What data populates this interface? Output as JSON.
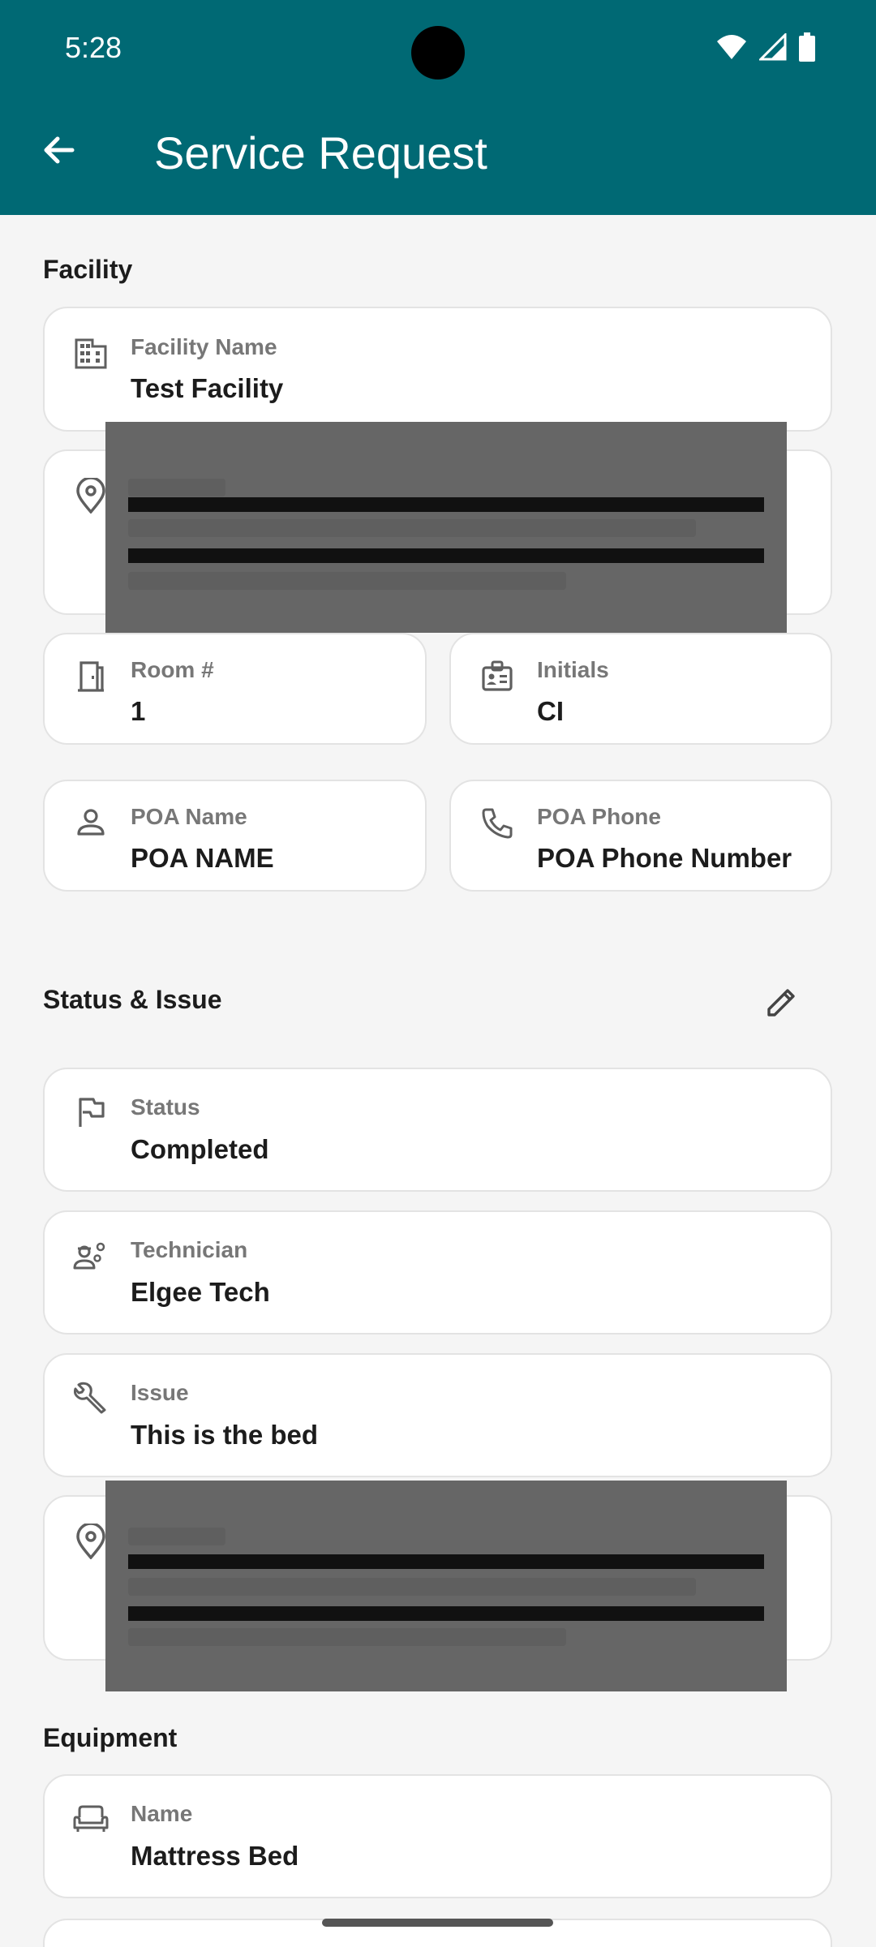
{
  "status_bar": {
    "time": "5:28"
  },
  "header": {
    "title": "Service Request"
  },
  "facility": {
    "section_title": "Facility",
    "facility_name_label": "Facility Name",
    "facility_name_value": "Test Facility",
    "room_label": "Room #",
    "room_value": "1",
    "initials_label": "Initials",
    "initials_value": "CI",
    "poa_name_label": "POA Name",
    "poa_name_value": "POA NAME",
    "poa_phone_label": "POA Phone",
    "poa_phone_value": "POA Phone Number"
  },
  "status_issue": {
    "section_title": "Status & Issue",
    "status_label": "Status",
    "status_value": "Completed",
    "technician_label": "Technician",
    "technician_value": "Elgee Tech",
    "issue_label": "Issue",
    "issue_value": "This is the bed"
  },
  "equipment": {
    "section_title": "Equipment",
    "name_label": "Name",
    "name_value": "Mattress Bed"
  },
  "icons": {
    "back": "arrow-back-icon",
    "edit": "pencil-icon",
    "facility": "building-icon",
    "address": "location-pin-icon",
    "room": "door-icon",
    "initials": "badge-icon",
    "poa_name": "person-icon",
    "poa_phone": "phone-icon",
    "status": "flag-icon",
    "technician": "engineer-icon",
    "issue": "wrench-icon",
    "equipment_name": "sofa-icon"
  },
  "colors": {
    "app_bar": "#006974",
    "background": "#f5f5f5",
    "card": "#ffffff",
    "label": "#777777"
  }
}
